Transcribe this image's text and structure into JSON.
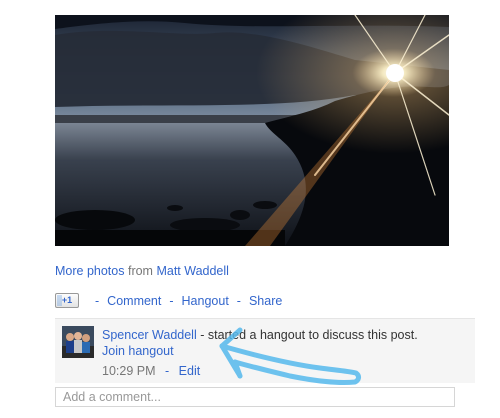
{
  "post": {
    "photo": {
      "subject": "sunset over a lake with rocky islands",
      "colors": {
        "sky": "#9aa7b6",
        "cloud": "#2a2f3a",
        "sun": "#fff6d8",
        "water": "#2b3340",
        "land": "#06080b"
      }
    },
    "attribution": {
      "more_photos": "More photos",
      "from": "from",
      "author": "Matt Waddell"
    },
    "actions": {
      "plusone_label": "+1",
      "separator": "-",
      "comment": "Comment",
      "hangout": "Hangout",
      "share": "Share"
    }
  },
  "hangout_notice": {
    "user": "Spencer Waddell",
    "message": " - started a hangout to discuss this post.",
    "join_label": "Join hangout",
    "time": "10:29 PM",
    "separator": "-",
    "edit_label": "Edit"
  },
  "comment_box": {
    "placeholder": "Add a comment..."
  },
  "annotation": {
    "type": "hand-drawn arrow",
    "color": "#55b8ec"
  },
  "colors": {
    "link": "#3366cc",
    "text": "#333333",
    "muted": "#777777",
    "panel": "#f5f5f5"
  }
}
